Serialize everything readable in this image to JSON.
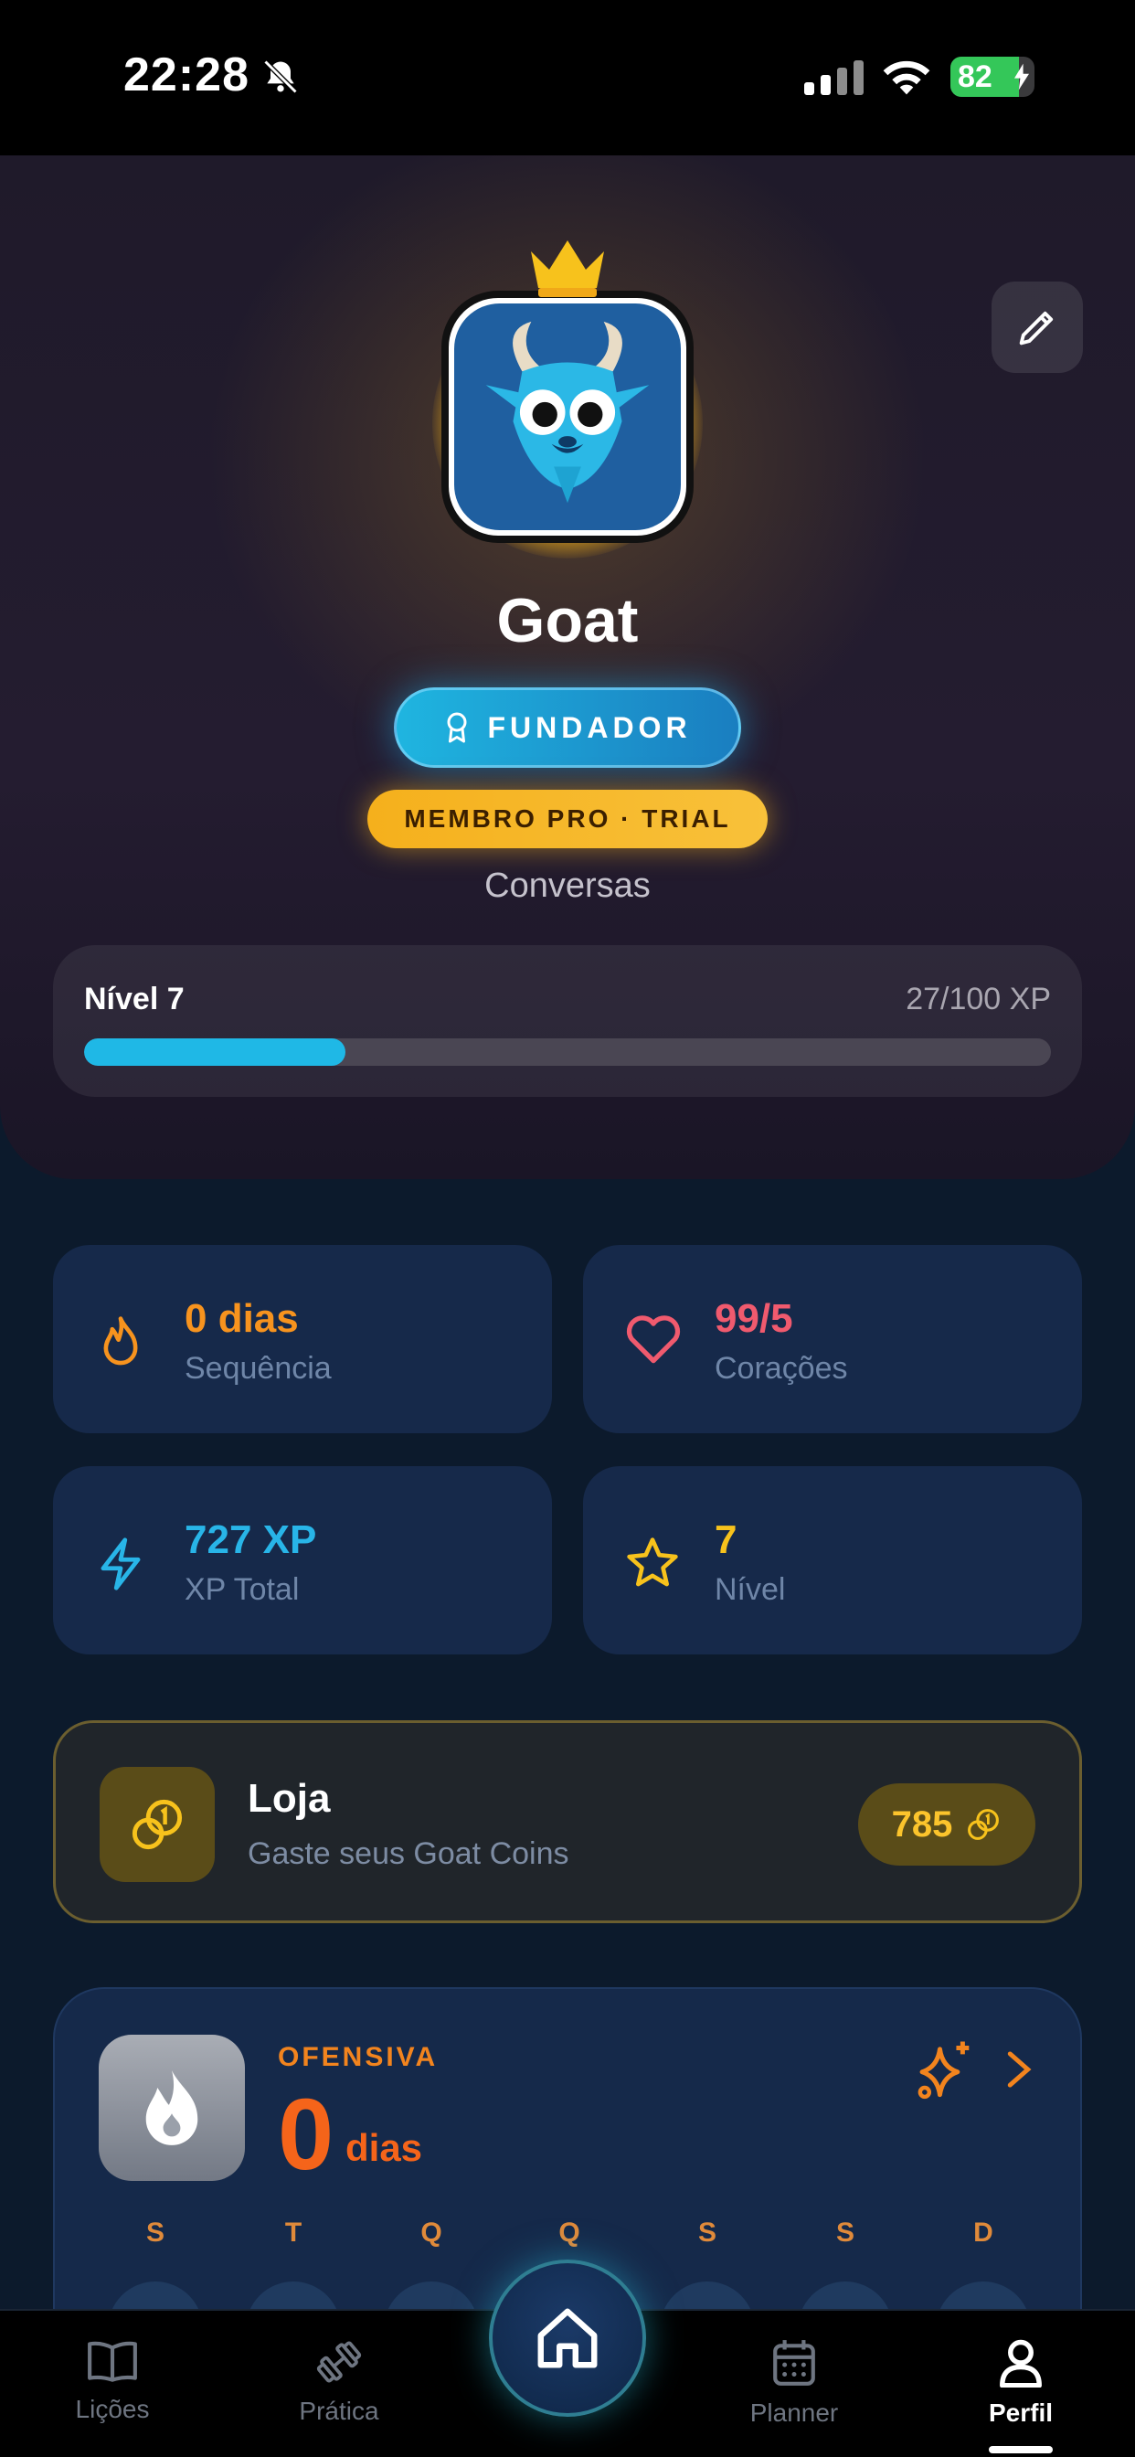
{
  "status_bar": {
    "time": "22:28",
    "battery": "82"
  },
  "profile": {
    "name": "Goat",
    "badge_founder": "FUNDADOR",
    "badge_pro": "MEMBRO PRO · TRIAL",
    "subtitle": "Conversas",
    "level_label": "Nível 7",
    "xp_progress": "27/100 XP",
    "xp_fraction": 0.27
  },
  "stats": [
    {
      "value": "0 dias",
      "label": "Sequência",
      "icon": "flame-icon",
      "color": "#f7931e"
    },
    {
      "value": "99/5",
      "label": "Corações",
      "icon": "heart-icon",
      "color": "#f05a6e"
    },
    {
      "value": "727 XP",
      "label": "XP Total",
      "icon": "lightning-icon",
      "color": "#28b5e8"
    },
    {
      "value": "7",
      "label": "Nível",
      "icon": "star-icon",
      "color": "#f7c21c"
    }
  ],
  "shop": {
    "title": "Loja",
    "subtitle": "Gaste seus Goat Coins",
    "coins": "785"
  },
  "streak": {
    "kicker": "OFENSIVA",
    "count": "0",
    "unit": "dias",
    "days": [
      "S",
      "T",
      "Q",
      "Q",
      "S",
      "S",
      "D"
    ]
  },
  "tabs": [
    {
      "label": "Lições",
      "icon": "book-icon"
    },
    {
      "label": "Prática",
      "icon": "dumbbell-icon"
    },
    {
      "label": "",
      "icon": "home-icon"
    },
    {
      "label": "Planner",
      "icon": "calendar-icon"
    },
    {
      "label": "Perfil",
      "icon": "person-icon",
      "active": true
    }
  ],
  "colors": {
    "accent": "#1fb8e6",
    "gold": "#f5b01c",
    "orange": "#f5641a",
    "background": "#0c1a2c"
  }
}
